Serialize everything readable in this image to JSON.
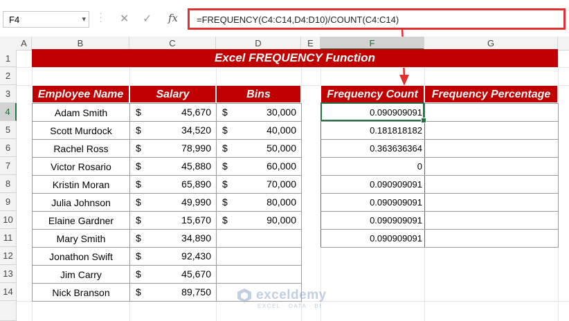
{
  "name_box": "F4",
  "formula": "=FREQUENCY(C4:C14,D4:D10)/COUNT(C4:C14)",
  "fx_label": "fx",
  "cancel_glyph": "✕",
  "enter_glyph": "✓",
  "columns": [
    "A",
    "B",
    "C",
    "D",
    "E",
    "F",
    "G"
  ],
  "rows": [
    "1",
    "2",
    "3",
    "4",
    "5",
    "6",
    "7",
    "8",
    "9",
    "10",
    "11",
    "12",
    "13",
    "14"
  ],
  "title": "Excel FREQUENCY Function",
  "headers": {
    "employee": "Employee Name",
    "salary": "Salary",
    "bins": "Bins",
    "freq_count": "Frequency Count",
    "freq_pct": "Frequency Percentage"
  },
  "currency": "$",
  "employees": [
    {
      "name": "Adam Smith",
      "salary": "45,670",
      "bin": "30,000"
    },
    {
      "name": "Scott Murdock",
      "salary": "34,520",
      "bin": "40,000"
    },
    {
      "name": "Rachel Ross",
      "salary": "78,990",
      "bin": "50,000"
    },
    {
      "name": "Victor Rosario",
      "salary": "45,880",
      "bin": "60,000"
    },
    {
      "name": "Kristin Moran",
      "salary": "65,890",
      "bin": "70,000"
    },
    {
      "name": "Julia Johnson",
      "salary": "49,990",
      "bin": "80,000"
    },
    {
      "name": "Elaine Gardner",
      "salary": "15,670",
      "bin": "90,000"
    },
    {
      "name": "Mary Smith",
      "salary": "34,890",
      "bin": ""
    },
    {
      "name": "Jonathon Swift",
      "salary": "92,430",
      "bin": ""
    },
    {
      "name": "Jim Carry",
      "salary": "45,670",
      "bin": ""
    },
    {
      "name": "Nick Branson",
      "salary": "89,750",
      "bin": ""
    }
  ],
  "freq_counts": [
    "0.090909091",
    "0.181818182",
    "0.363636364",
    "0",
    "0.090909091",
    "0.090909091",
    "0.090909091",
    "0.090909091"
  ],
  "watermark": {
    "name": "exceldemy",
    "sub": "EXCEL · DATA · BI"
  },
  "colors": {
    "header_red": "#c00000",
    "excel_green": "#217346",
    "highlight_red": "#e03030"
  }
}
